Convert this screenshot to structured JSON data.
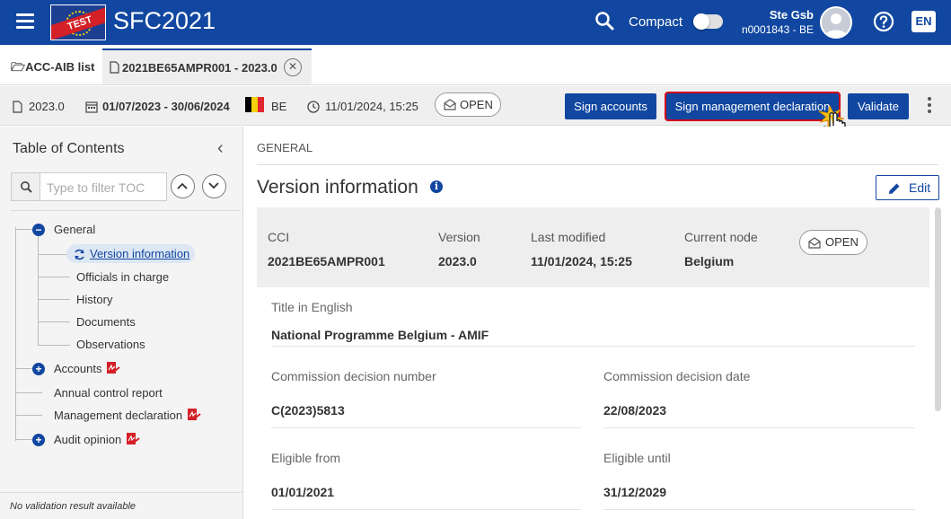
{
  "header": {
    "logo_badge": "TEST",
    "app_title": "SFC2021",
    "compact_label": "Compact",
    "user_name": "Ste Gsb",
    "user_id": "n0001843 - BE",
    "language": "EN"
  },
  "tabs": {
    "list_tab": "ACC-AIB list",
    "active_tab": "2021BE65AMPR001 - 2023.0"
  },
  "infobar": {
    "version": "2023.0",
    "period": "01/07/2023 - 30/06/2024",
    "country": "BE",
    "timestamp": "11/01/2024, 15:25",
    "status": "OPEN",
    "sign_accounts": "Sign accounts",
    "sign_management": "Sign management declaration",
    "validate": "Validate"
  },
  "toc": {
    "title": "Table of Contents",
    "filter_placeholder": "Type to filter TOC",
    "items": [
      {
        "label": "General"
      },
      {
        "label": "Version information"
      },
      {
        "label": "Officials in charge"
      },
      {
        "label": "History"
      },
      {
        "label": "Documents"
      },
      {
        "label": "Observations"
      },
      {
        "label": "Accounts"
      },
      {
        "label": "Annual control report"
      },
      {
        "label": "Management declaration"
      },
      {
        "label": "Audit opinion"
      }
    ],
    "footer": "No validation result available"
  },
  "main": {
    "section": "GENERAL",
    "title": "Version information",
    "edit": "Edit",
    "header_fields": {
      "cci_label": "CCI",
      "cci_value": "2021BE65AMPR001",
      "version_label": "Version",
      "version_value": "2023.0",
      "modified_label": "Last modified",
      "modified_value": "11/01/2024, 15:25",
      "node_label": "Current node",
      "node_value": "Belgium",
      "status": "OPEN"
    },
    "fields": {
      "title_label": "Title in English",
      "title_value": "National Programme Belgium - AMIF",
      "decision_no_label": "Commission decision number",
      "decision_no_value": "C(2023)5813",
      "decision_date_label": "Commission decision date",
      "decision_date_value": "22/08/2023",
      "eligible_from_label": "Eligible from",
      "eligible_from_value": "01/01/2021",
      "eligible_until_label": "Eligible until",
      "eligible_until_value": "31/12/2029"
    }
  },
  "colors": {
    "brand": "#1147a0",
    "highlight": "#d0021b",
    "flag": [
      "#000000",
      "#f5d20b",
      "#e2262f"
    ]
  }
}
